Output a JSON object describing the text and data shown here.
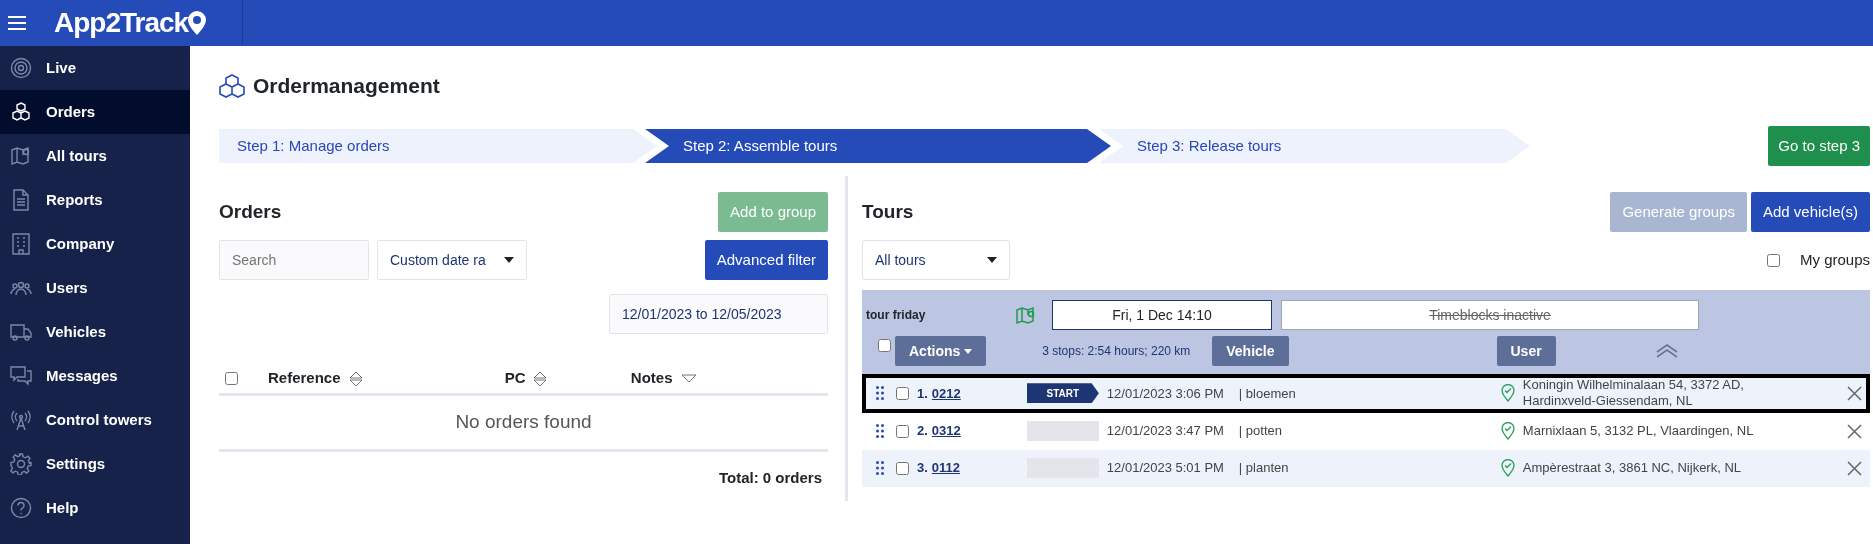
{
  "app": {
    "logo": "App2Track"
  },
  "sidebar": {
    "items": [
      {
        "label": "Live",
        "selected": false
      },
      {
        "label": "Orders",
        "selected": true
      },
      {
        "label": "All tours",
        "selected": false
      },
      {
        "label": "Reports",
        "selected": false
      },
      {
        "label": "Company",
        "selected": false
      },
      {
        "label": "Users",
        "selected": false
      },
      {
        "label": "Vehicles",
        "selected": false
      },
      {
        "label": "Messages",
        "selected": false
      },
      {
        "label": "Control towers",
        "selected": false
      },
      {
        "label": "Settings",
        "selected": false
      },
      {
        "label": "Help",
        "selected": false
      }
    ]
  },
  "page": {
    "title": "Ordermanagement"
  },
  "steps": [
    {
      "label": "Step 1: Manage orders",
      "selected": false
    },
    {
      "label": "Step 2: Assemble tours",
      "selected": true
    },
    {
      "label": "Step 3: Release tours",
      "selected": false
    }
  ],
  "next_button": "Go to step 3",
  "orders": {
    "title": "Orders",
    "add_to_group": {
      "label": "Add to group",
      "disabled": true
    },
    "search": {
      "placeholder": "Search"
    },
    "date_filter": "Custom date ra",
    "advanced_filter": "Advanced filter",
    "date_range": "12/01/2023 to 12/05/2023",
    "select_all_checked": false,
    "columns": [
      {
        "label": "Reference",
        "sorted_desc": false
      },
      {
        "label": "PC",
        "sorted_desc": false
      },
      {
        "label": "Notes",
        "sorted_desc": true
      }
    ],
    "empty_text": "No orders found",
    "total": "Total: 0 orders"
  },
  "tours": {
    "title": "Tours",
    "generate_groups": {
      "label": "Generate groups",
      "disabled": true
    },
    "add_vehicles": {
      "label": "Add vehicle(s)",
      "disabled": false
    },
    "filter": "All tours",
    "my_groups": {
      "label": "My groups",
      "checked": false
    },
    "group": {
      "name": "tour friday",
      "date": "Fri, 1 Dec 14:10",
      "timeblocks": "Timeblocks inactive",
      "timeblocks_inactive": true,
      "checked": false,
      "actions": "Actions",
      "summary": "3 stops: 2:54 hours; 220 km",
      "vehicle": "Vehicle",
      "user": "User",
      "expanded": true,
      "stops": [
        {
          "number": "1.",
          "reference": "0212",
          "kind": "start",
          "badge": "START",
          "time": "12/01/2023 3:06 PM",
          "note": "| bloemen",
          "address": "Koningin Wilhelminalaan 54, 3372 AD, Hardinxveld-Giessendam, NL",
          "checked": false,
          "selected": true
        },
        {
          "number": "2.",
          "reference": "0312",
          "kind": "stop",
          "time": "12/01/2023 3:47 PM",
          "note": "| potten",
          "address": "Marnixlaan 5, 3132 PL, Vlaardingen, NL",
          "checked": false,
          "selected": false
        },
        {
          "number": "3.",
          "reference": "0112",
          "kind": "stop",
          "time": "12/01/2023 5:01 PM",
          "note": "| planten",
          "address": "Ampèrestraat 3, 3861 NC, Nijkerk, NL",
          "checked": false,
          "selected": false
        }
      ]
    }
  }
}
